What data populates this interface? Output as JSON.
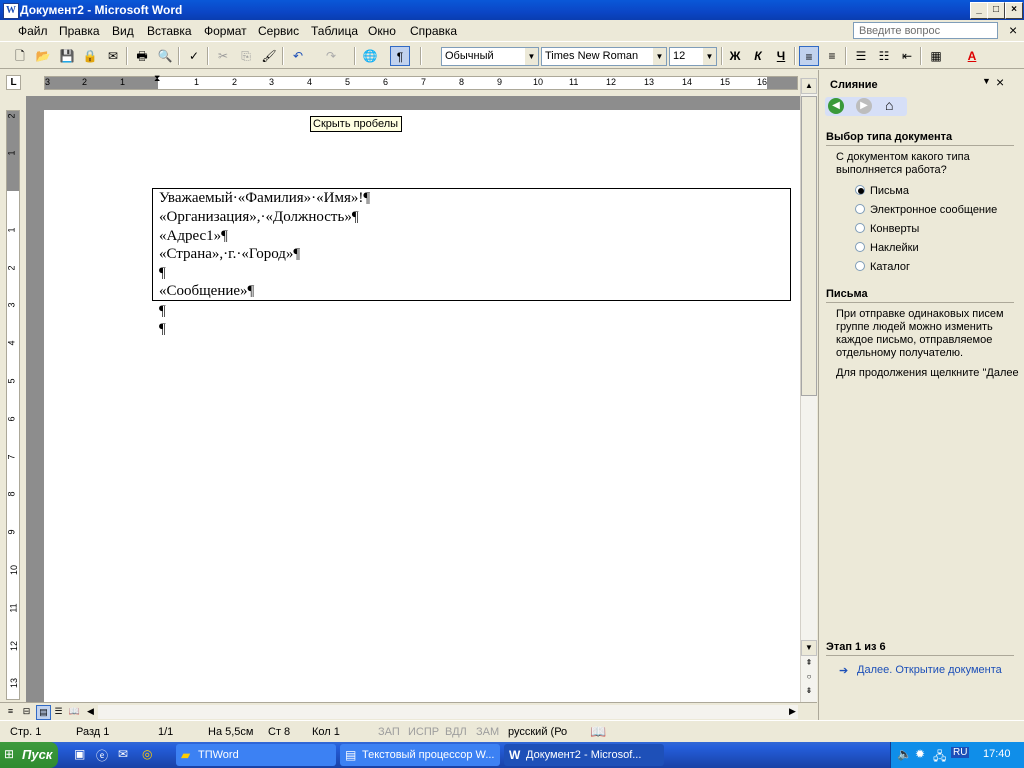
{
  "window": {
    "title": "Документ2 - Microsoft Word",
    "min": "_",
    "max": "□",
    "close": "×"
  },
  "menu": {
    "items": [
      "Файл",
      "Правка",
      "Вид",
      "Вставка",
      "Формат",
      "Сервис",
      "Таблица",
      "Окно",
      "Справка"
    ],
    "ask_placeholder": "Введите вопрос",
    "close": "×"
  },
  "toolbar": {
    "style": "Обычный",
    "font": "Times New Roman",
    "size": "12",
    "bold": "Ж",
    "italic": "К",
    "underline": "Ч",
    "pilcrow": "¶",
    "tooltip": "Скрыть пробелы"
  },
  "ruler": {
    "h_numbers": [
      "3",
      "2",
      "1",
      "1",
      "2",
      "3",
      "4",
      "5",
      "6",
      "7",
      "8",
      "9",
      "10",
      "11",
      "12",
      "13",
      "14",
      "15",
      "16"
    ],
    "v_numbers": [
      "2",
      "1",
      "1",
      "2",
      "3",
      "4",
      "5",
      "6",
      "7",
      "8",
      "9",
      "10",
      "11",
      "12",
      "13"
    ]
  },
  "document": {
    "lines": [
      "Уважаемый·«Фамилия»·«Имя»!¶",
      "«Организация»,·«Должность»¶",
      "«Адрес1»¶",
      "«Страна»,·г.·«Город»¶",
      "¶",
      "«Сообщение»¶",
      "¶",
      "¶"
    ]
  },
  "taskpane": {
    "title": "Слияние",
    "section1": "Выбор типа документа",
    "question": [
      "С документом какого типа",
      "выполняется работа?"
    ],
    "options": [
      "Письма",
      "Электронное сообщение",
      "Конверты",
      "Наклейки",
      "Каталог"
    ],
    "selected": 0,
    "section2": "Письма",
    "description": [
      "При отправке одинаковых писем",
      "группе людей можно изменить",
      "каждое письмо, отправляемое",
      "отдельному получателю."
    ],
    "continue": "Для продолжения щелкните \"Далее",
    "step": "Этап 1 из 6",
    "next_link": "Далее. Открытие документа"
  },
  "status": {
    "page": "Стр. 1",
    "section": "Разд 1",
    "pages": "1/1",
    "at": "На 5,5см",
    "line": "Ст 8",
    "col": "Кол 1",
    "rec": "ЗАП",
    "trk": "ИСПР",
    "ext": "ВДЛ",
    "ovr": "ЗАМ",
    "lang": "русский (Ро"
  },
  "taskbar": {
    "start": "Пуск",
    "tasks": [
      "TПWord",
      "Текстовый процессор W...",
      "Документ2 - Microsof..."
    ],
    "lang": "RU",
    "time": "17:40"
  }
}
